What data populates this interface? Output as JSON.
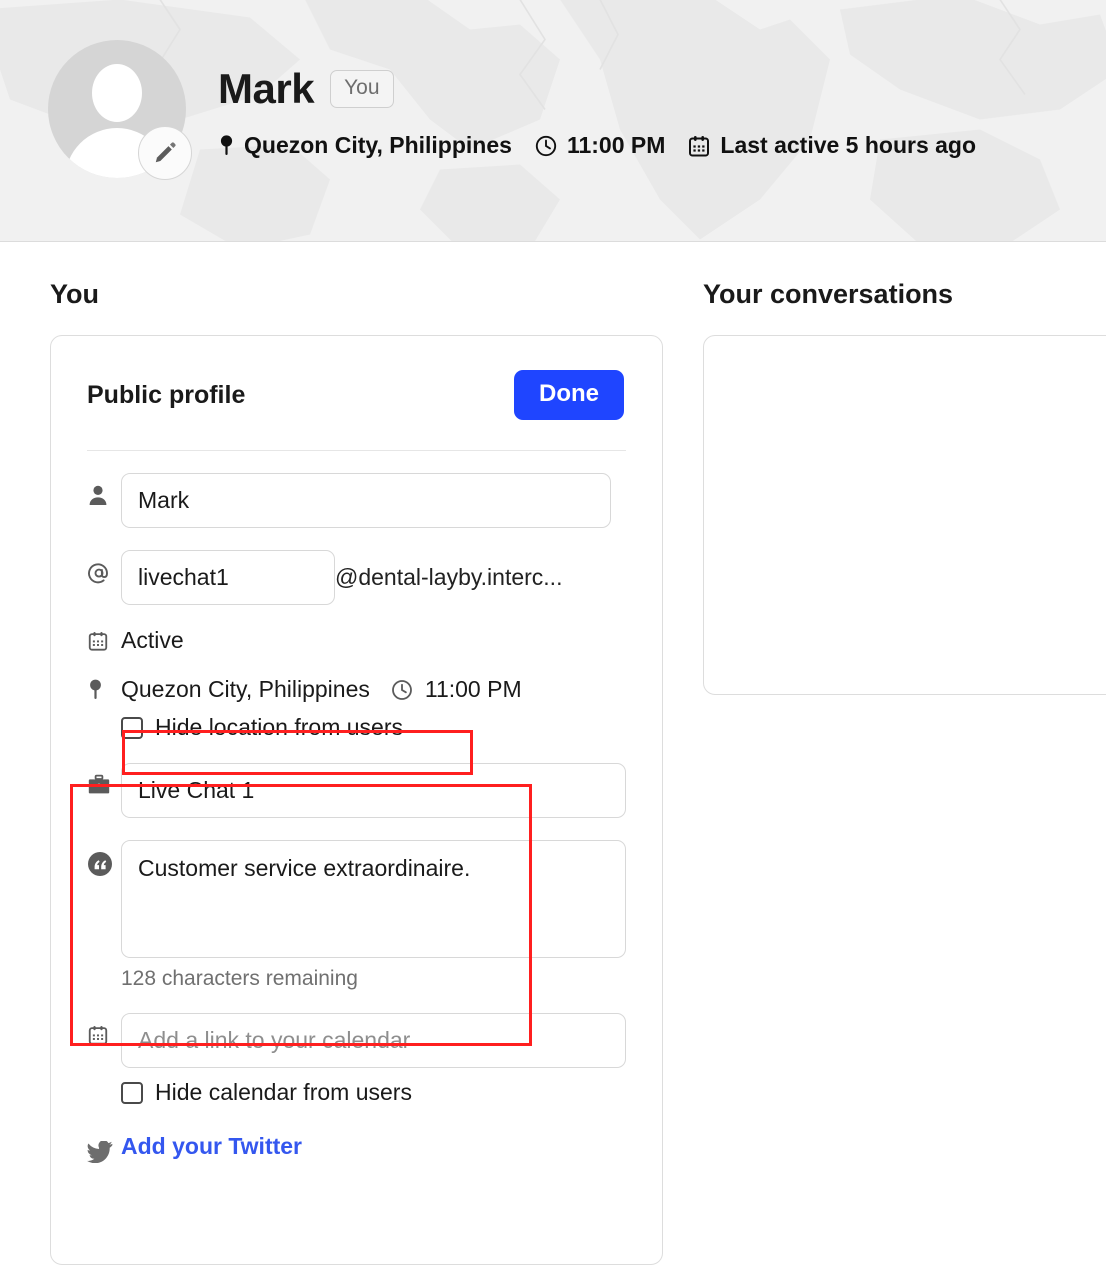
{
  "header": {
    "name": "Mark",
    "you_badge": "You",
    "location": "Quezon City, Philippines",
    "time": "11:00 PM",
    "last_active": "Last active 5 hours ago",
    "location_icon": "map-pin-icon",
    "clock_icon": "clock-icon",
    "calendar_icon": "calendar-icon",
    "avatar_icon": "default-avatar-icon",
    "edit_icon": "pencil-edit-icon",
    "background": "#f1f1f1"
  },
  "left_column": {
    "section_title": "You",
    "card": {
      "title": "Public profile",
      "done_label": "Done",
      "fields": {
        "name": {
          "icon": "person-icon",
          "value": "Mark"
        },
        "username": {
          "icon": "at-sign-icon",
          "value": "livechat1",
          "domain_suffix": "@dental-layby.interc..."
        },
        "status": {
          "icon": "calendar-icon",
          "value": "Active"
        },
        "location": {
          "icon": "map-pin-icon",
          "value": "Quezon City, Philippines",
          "clock_icon": "clock-icon",
          "time": "11:00 PM"
        },
        "hide_location": {
          "label": "Hide location from users",
          "checked": false
        },
        "job_title": {
          "icon": "briefcase-icon",
          "value": "Live Chat 1"
        },
        "bio": {
          "icon": "quote-icon",
          "value": "Customer service extraordinaire.",
          "characters_remaining": "128 characters remaining"
        },
        "calendar_link": {
          "icon": "calendar-icon",
          "value": "",
          "placeholder": "Add a link to your calendar"
        },
        "hide_calendar": {
          "label": "Hide calendar from users",
          "checked": false
        },
        "twitter": {
          "icon": "twitter-bird-icon",
          "link_label": "Add your Twitter",
          "link_color": "#3457ef"
        }
      }
    }
  },
  "right_column": {
    "section_title": "Your conversations",
    "panel_content": ""
  },
  "annotations": {
    "accent_color": "#ff1f1f",
    "boxes": [
      {
        "name": "hide-location-highlight"
      },
      {
        "name": "job-and-bio-highlight"
      }
    ]
  },
  "theme": {
    "primary_button": "#1f45ff",
    "link": "#3457ef",
    "border": "#dddddd",
    "text": "#1a1a1a",
    "muted_text": "#707070"
  }
}
